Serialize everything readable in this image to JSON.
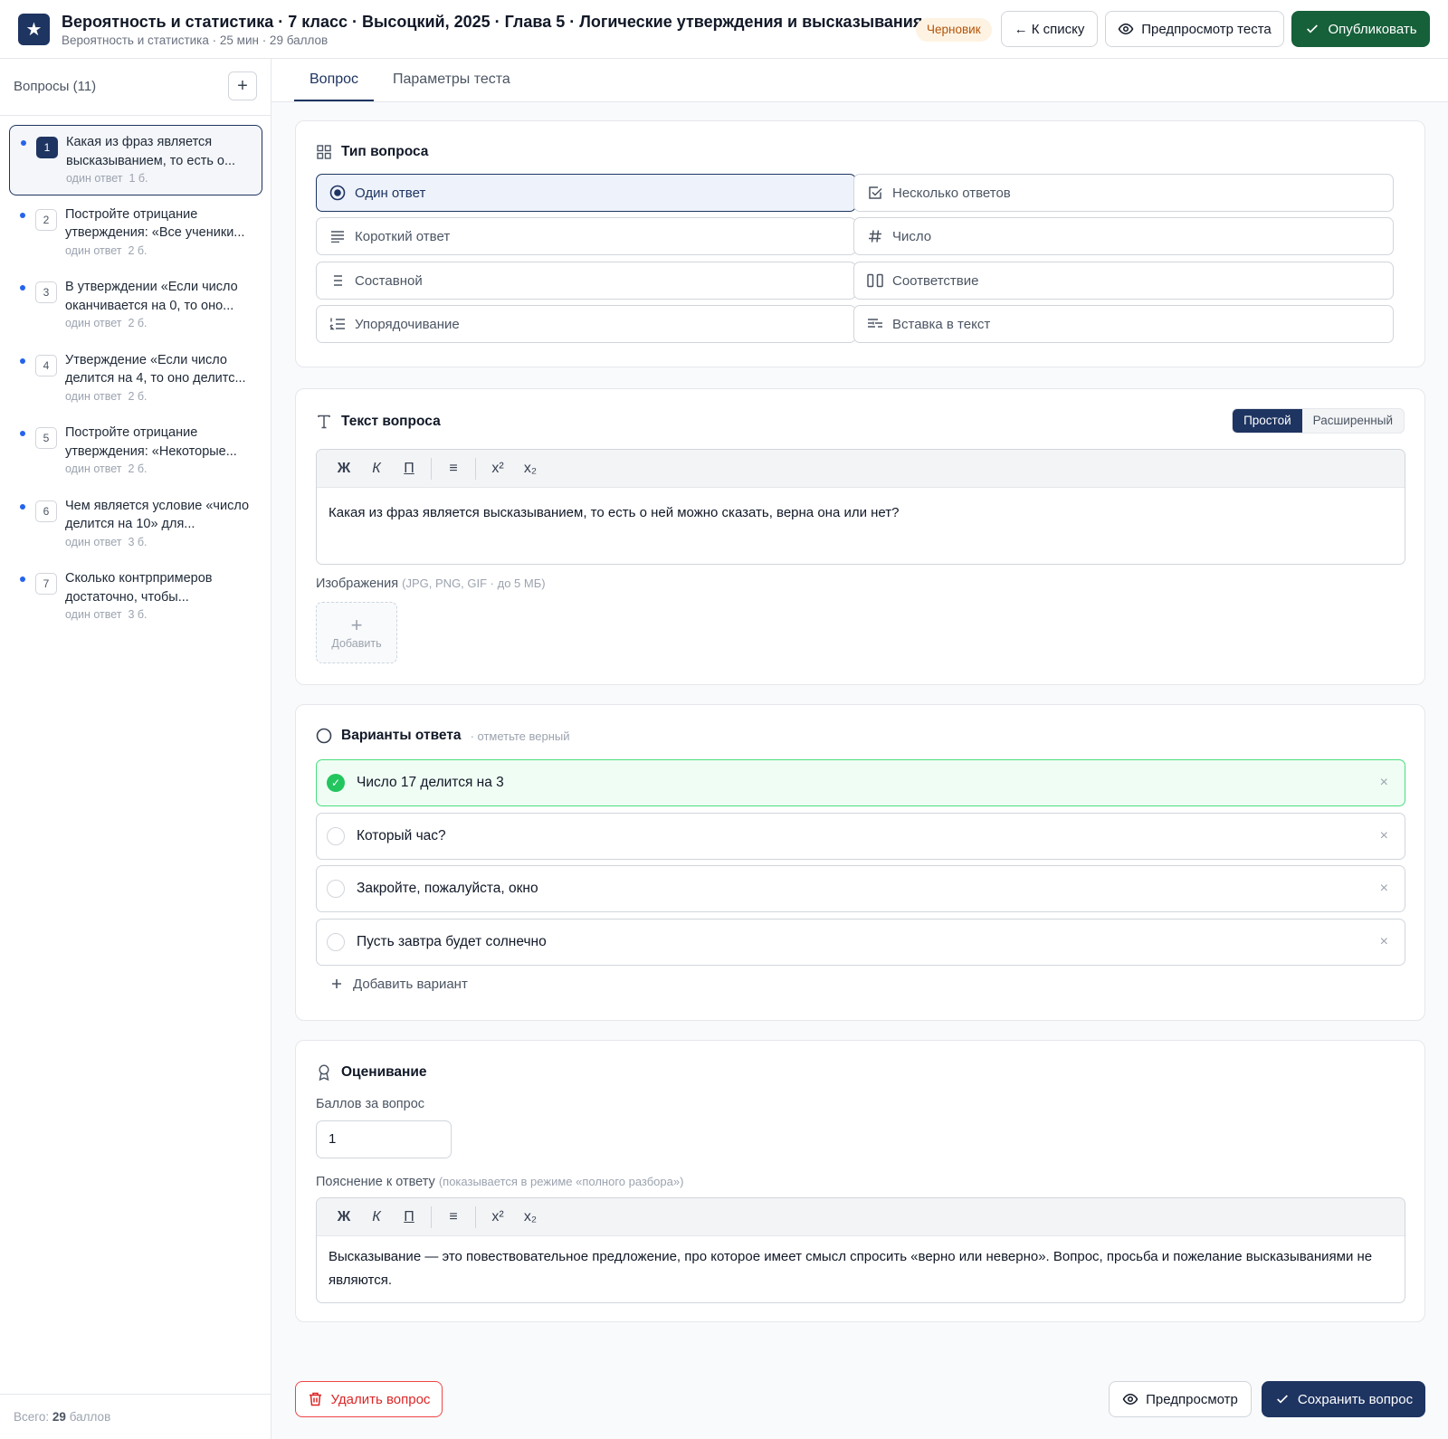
{
  "header": {
    "logo_glyph": "★",
    "title": "Вероятность и статистика · 7 класс · Высоцкий, 2025 · Глава 5 · Логические утверждения и высказывания",
    "subtitle": "Вероятность и статистика · 25 мин · 29 баллов",
    "status_badge": "Черновик",
    "back_label": "← К списку",
    "preview_label": "Предпросмотр теста",
    "publish_label": "Опубликовать"
  },
  "sidebar": {
    "title": "Вопросы (11)",
    "add_glyph": "+",
    "items": [
      {
        "num": "1",
        "line1": "Какая из фраз является",
        "line2": "высказыванием, то есть о...",
        "type": "один ответ",
        "points": "1 б."
      },
      {
        "num": "2",
        "line1": "Постройте отрицание",
        "line2": "утверждения: «Все ученики...",
        "type": "один ответ",
        "points": "2 б."
      },
      {
        "num": "3",
        "line1": "В утверждении «Если число",
        "line2": "оканчивается на 0, то оно...",
        "type": "один ответ",
        "points": "2 б."
      },
      {
        "num": "4",
        "line1": "Утверждение «Если число",
        "line2": "делится на 4, то оно делитс...",
        "type": "один ответ",
        "points": "2 б."
      },
      {
        "num": "5",
        "line1": "Постройте отрицание",
        "line2": "утверждения: «Некоторые...",
        "type": "один ответ",
        "points": "2 б."
      },
      {
        "num": "6",
        "line1": "Чем является условие «число",
        "line2": "делится на 10» для...",
        "type": "один ответ",
        "points": "3 б."
      },
      {
        "num": "7",
        "line1": "Сколько контрпримеров",
        "line2": "достаточно, чтобы...",
        "type": "один ответ",
        "points": "3 б."
      }
    ],
    "total_prefix": "Всего:",
    "total_value": "29",
    "total_suffix": "баллов"
  },
  "tabs": [
    "Вопрос",
    "Параметры теста"
  ],
  "question_type": {
    "title": "Тип вопроса",
    "options": [
      "Один ответ",
      "Несколько ответов",
      "Короткий ответ",
      "Число",
      "Составной",
      "Соответствие",
      "Упорядочивание",
      "Вставка в текст"
    ],
    "selected": "Один ответ"
  },
  "question_text": {
    "title": "Текст вопроса",
    "mode_simple": "Простой",
    "mode_advanced": "Расширенный",
    "toolbar": {
      "bold": "Ж",
      "italic": "К",
      "underline": "П",
      "list": "≡",
      "sup": "x²",
      "sub": "x₂"
    },
    "content": "Какая из фраз является высказыванием, то есть о ней можно сказать, верна она или нет?",
    "images_label": "Изображения",
    "images_hint": "(JPG, PNG, GIF · до 5 МБ)",
    "add_image_glyph": "+",
    "add_image_label": "Добавить"
  },
  "answers": {
    "title": "Варианты ответа",
    "hint": "· отметьте верный",
    "options": [
      {
        "text": "Число 17 делится на 3",
        "correct": true
      },
      {
        "text": "Который час?",
        "correct": false
      },
      {
        "text": "Закройте, пожалуйста, окно",
        "correct": false
      },
      {
        "text": "Пусть завтра будет солнечно",
        "correct": false
      }
    ],
    "remove_glyph": "×",
    "check_glyph": "✓",
    "add_label": "Добавить вариант"
  },
  "grading": {
    "title": "Оценивание",
    "points_label": "Баллов за вопрос",
    "points_value": "1",
    "explanation_label": "Пояснение к ответу",
    "explanation_hint": "(показывается в режиме «полного разбора»)",
    "explanation_text": "Высказывание — это повествовательное предложение, про которое имеет смысл спросить «верно или неверно». Вопрос, просьба и пожелание высказываниями не являются."
  },
  "footer": {
    "delete_label": "Удалить вопрос",
    "preview_label": "Предпросмотр",
    "save_label": "Сохранить вопрос"
  },
  "colors": {
    "brand": "#1e3461",
    "publish": "#16603a",
    "correct": "#22c55e",
    "danger": "#dc2626",
    "draft": "#b45309"
  }
}
